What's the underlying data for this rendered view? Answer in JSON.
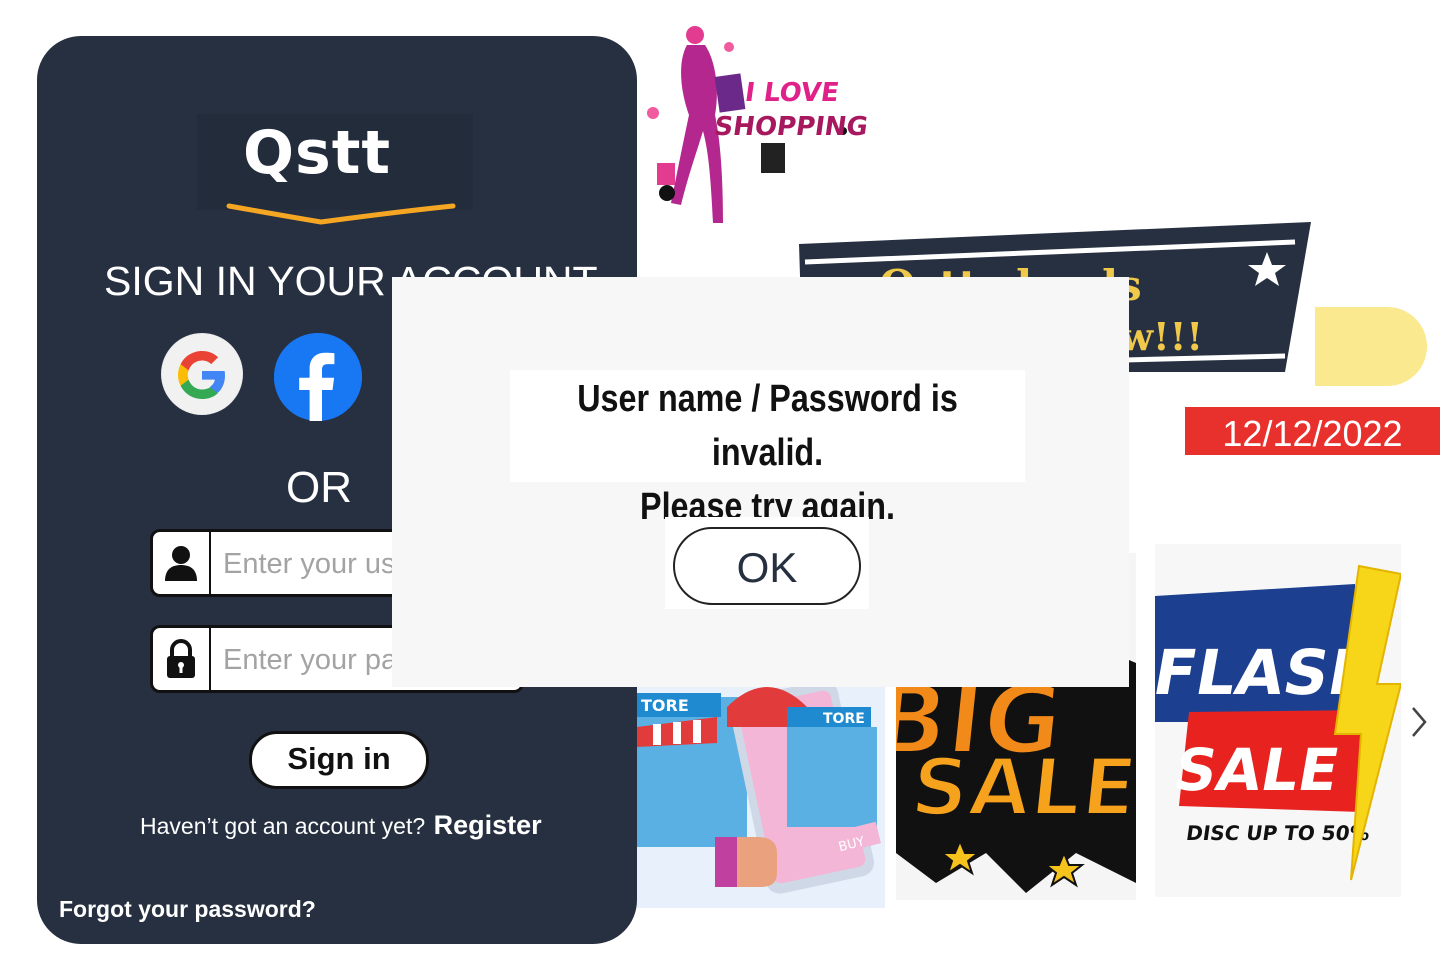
{
  "signin": {
    "logo_text": "Qstt",
    "title": "SIGN IN YOUR ACCOUNT",
    "or_text": "OR",
    "username_placeholder": "Enter your username",
    "password_placeholder": "Enter your password",
    "signin_button": "Sign in",
    "register_question": "Haven’t got an account yet?",
    "register_link": "Register",
    "forgot_password": "Forgot your password?",
    "social": [
      "google-icon",
      "facebook-icon"
    ]
  },
  "promos": {
    "shopping_text_1": "I LOVE",
    "shopping_text_2": "SHOPPING",
    "banner_text_1": "Qstt sh ads",
    "banner_text_2": "ow!!!",
    "date": "12/12/2022",
    "store_sign_1": "TORE",
    "store_sign_2": "TORE",
    "store_buy": "BUY",
    "bigsale_1": "BIG",
    "bigsale_2": "SALE",
    "flash_1": "FLASH",
    "flash_2": "SALE",
    "flash_disc": "DISC UP TO 50%"
  },
  "modal": {
    "message_line1": "User name / Password is invalid.",
    "message_line2": "Please try again.",
    "ok_button": "OK"
  },
  "colors": {
    "panel_bg": "#263040",
    "accent_orange": "#f5a623",
    "facebook_blue": "#1877f2",
    "date_red": "#e8302c"
  }
}
